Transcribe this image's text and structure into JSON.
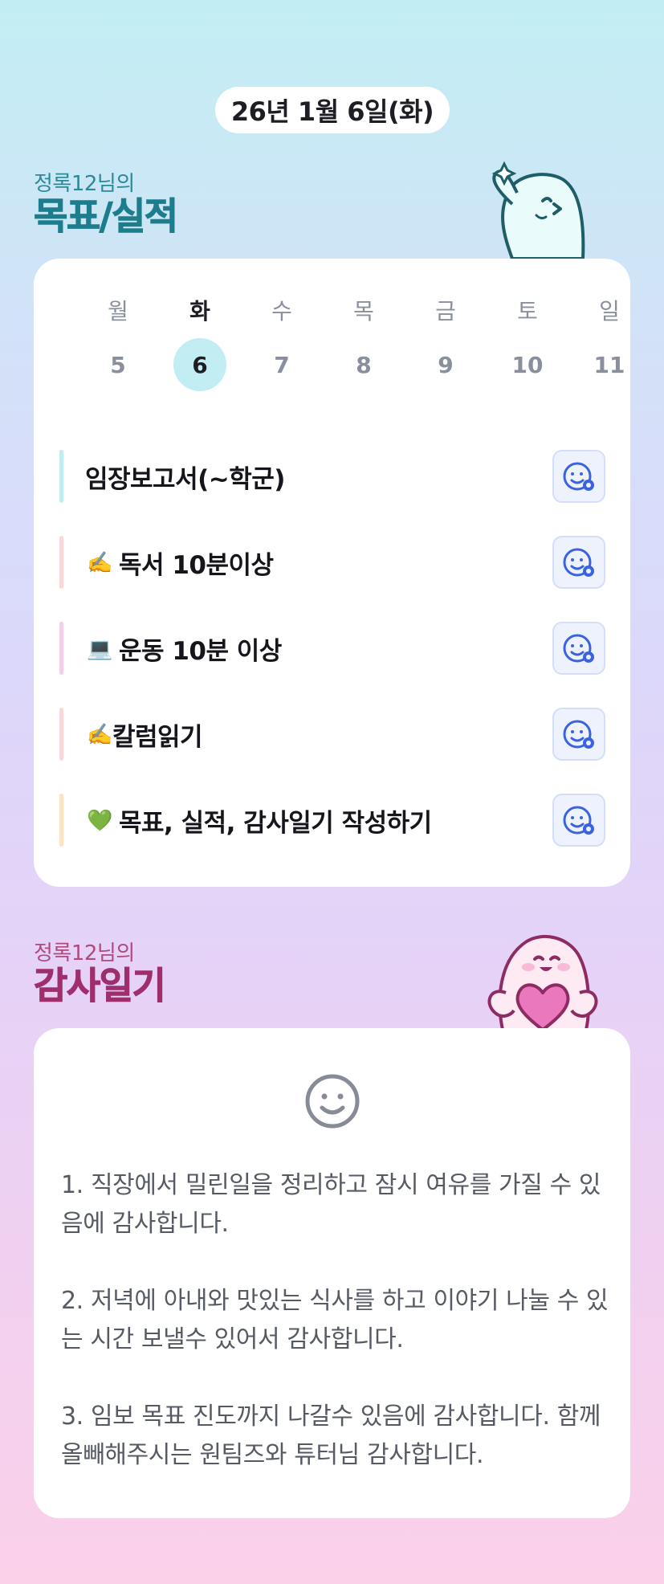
{
  "date_label": "26년 1월 6일(화)",
  "goals_section": {
    "subtitle": "정록12님의",
    "title": "목표/실적"
  },
  "week": {
    "days": [
      {
        "name": "월",
        "num": "5",
        "active": false
      },
      {
        "name": "화",
        "num": "6",
        "active": true
      },
      {
        "name": "수",
        "num": "7",
        "active": false
      },
      {
        "name": "목",
        "num": "8",
        "active": false
      },
      {
        "name": "금",
        "num": "9",
        "active": false
      },
      {
        "name": "토",
        "num": "10",
        "active": false
      },
      {
        "name": "일",
        "num": "11",
        "active": false
      }
    ]
  },
  "goals": [
    {
      "emoji": "",
      "text": "임장보고서(~학군)",
      "bar_color": "#bfeef2"
    },
    {
      "emoji": "✍️",
      "text": "독서 10분이상",
      "bar_color": "#fbd8d8"
    },
    {
      "emoji": "💻",
      "text": "운동 10분 이상",
      "bar_color": "#f6cfe6"
    },
    {
      "emoji": "✍️",
      "text": "칼럼읽기",
      "bar_color": "#fbd8d8"
    },
    {
      "emoji": "💚",
      "text": "목표, 실적, 감사일기 작성하기",
      "bar_color": "#fde2c4"
    }
  ],
  "gratitude_section": {
    "subtitle": "정록12님의",
    "title": "감사일기"
  },
  "gratitude": [
    "1. 직장에서 밀린일을 정리하고 잠시 여유를 가질 수 있음에 감사합니다.",
    "2. 저녁에 아내와 맛있는 식사를 하고 이야기 나눌 수 있는 시간 보낼수 있어서 감사합니다.",
    "3. 임보 목표 진도까지 나갈수 있음에 감사합니다. 함께 올빼해주시는 원팀즈와 튜터님 감사합니다."
  ],
  "colors": {
    "accent_teal": "#1c7e8c",
    "accent_plum": "#9e2f6c",
    "icon_blue": "#3b63e0"
  }
}
